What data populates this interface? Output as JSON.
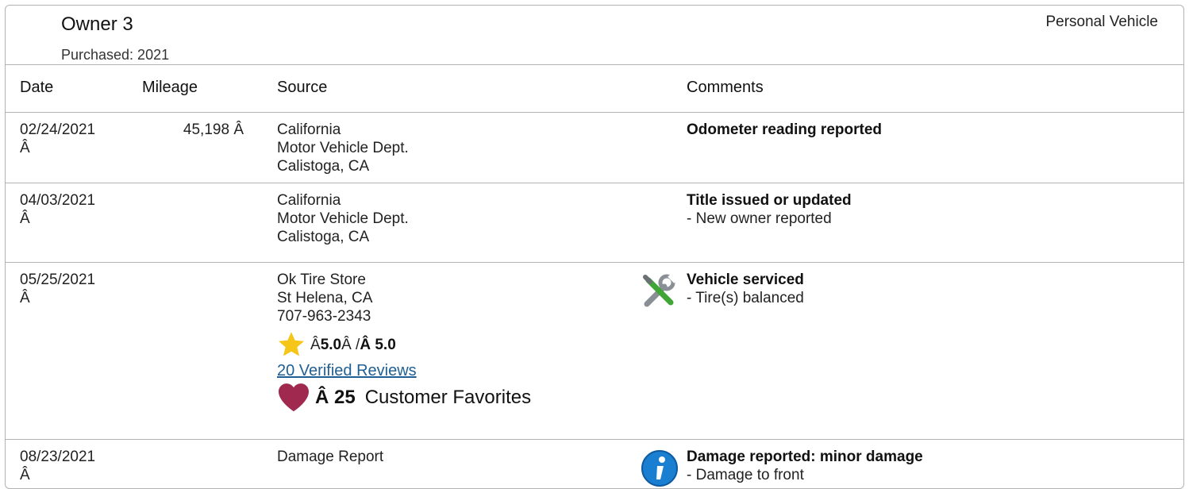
{
  "owner": {
    "title": "Owner 3",
    "purchased": "Purchased: 2021",
    "vehicle_type": "Personal Vehicle"
  },
  "columns": [
    "Date",
    "Mileage",
    "Source",
    "Comments"
  ],
  "rows": [
    {
      "date": "02/24/2021",
      "date_suffix": "Â",
      "mileage": "45,198 Â",
      "source": [
        "California",
        "Motor Vehicle Dept.",
        "Calistoga, CA"
      ],
      "comment_title": "Odometer reading reported",
      "comment_detail": ""
    },
    {
      "date": "04/03/2021",
      "date_suffix": "Â",
      "mileage": "",
      "source": [
        "California",
        "Motor Vehicle Dept.",
        "Calistoga, CA"
      ],
      "comment_title": "Title issued or updated",
      "comment_detail": "- New owner reported"
    },
    {
      "date": "05/25/2021",
      "date_suffix": "Â",
      "mileage": "",
      "source": [
        "Ok Tire Store",
        "St Helena, CA",
        "707-963-2343"
      ],
      "comment_title": "Vehicle serviced",
      "comment_detail": "- Tire(s) balanced",
      "icon": "tools-icon",
      "rating": {
        "prefix": "Â ",
        "score": "5.0",
        "sep": "Â /",
        "max": "Â 5.0"
      },
      "reviews_link": "20 Verified Reviews",
      "favorites": {
        "count": "Â 25",
        "label": "Customer Favorites"
      }
    },
    {
      "date": "08/23/2021",
      "date_suffix": "Â",
      "mileage": "",
      "source": [
        "Damage Report"
      ],
      "comment_title": "Damage reported: minor damage",
      "comment_detail": "- Damage to front",
      "icon": "info-icon"
    }
  ],
  "colors": {
    "border": "#b3b3b3",
    "link": "#1f5f93",
    "star": "#f5c518",
    "heart": "#a0294f",
    "info": "#1a7fd0"
  }
}
